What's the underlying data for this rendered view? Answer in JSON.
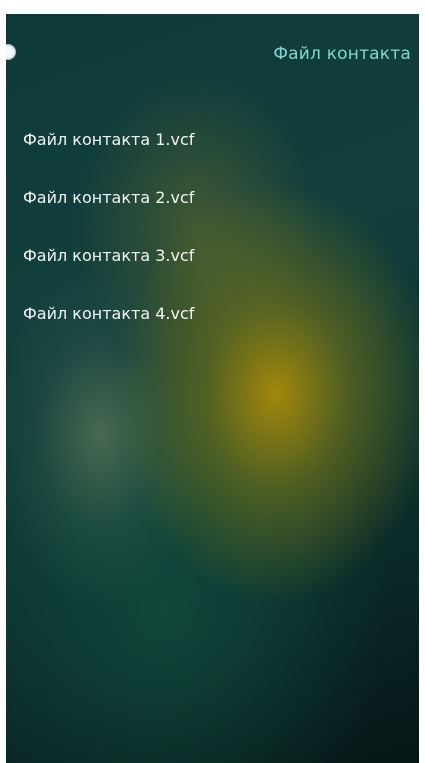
{
  "header": {
    "title": "Файл контакта"
  },
  "files": [
    {
      "label": "Файл контакта 1.vcf"
    },
    {
      "label": "Файл контакта 2.vcf"
    },
    {
      "label": "Файл контакта 3.vcf"
    },
    {
      "label": "Файл контакта 4.vcf"
    }
  ],
  "colors": {
    "title": "#7fd9cf",
    "item_text": "#f2f4f3",
    "background": "#0f3a3a",
    "glow": "#b08a0a"
  }
}
